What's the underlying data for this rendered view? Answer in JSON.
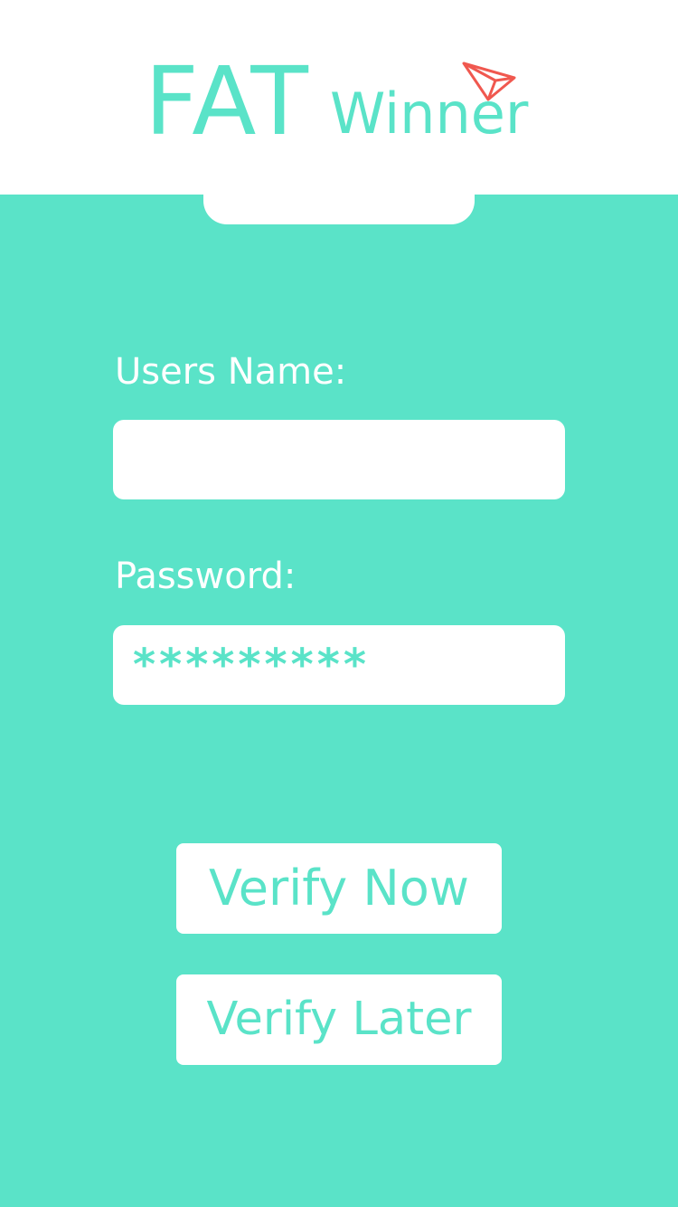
{
  "header": {
    "logo_primary": "FAT",
    "logo_secondary": "Winner",
    "logo_icon": "paper-plane-icon"
  },
  "form": {
    "username_label": "Users Name:",
    "username_value": "",
    "password_label": "Password:",
    "password_value": "*********"
  },
  "actions": {
    "verify_now_label": "Verify Now",
    "verify_later_label": "Verify Later"
  },
  "colors": {
    "accent": "#5ae3c8",
    "surface": "#ffffff",
    "icon": "#f0584f"
  }
}
